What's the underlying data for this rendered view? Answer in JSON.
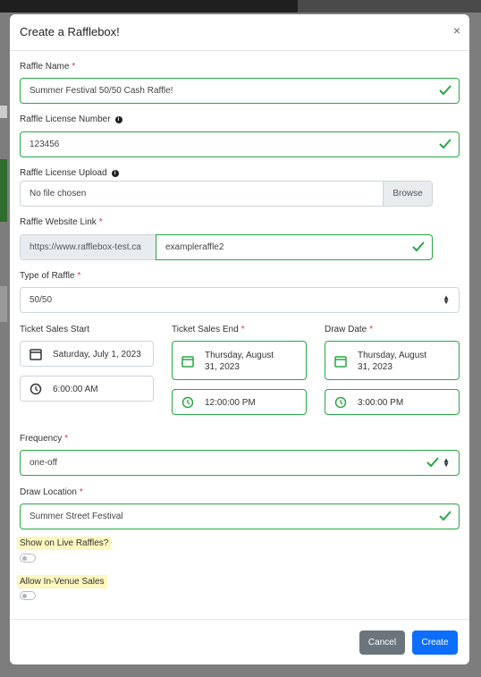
{
  "modal": {
    "title": "Create a Rafflebox!",
    "close_glyph": "×"
  },
  "raffle_name": {
    "label": "Raffle Name",
    "required": "*",
    "value": "Summer Festival 50/50 Cash Raffle!"
  },
  "license_number": {
    "label": "Raffle License Number",
    "info": "i",
    "value": "123456"
  },
  "license_upload": {
    "label": "Raffle License Upload",
    "info": "i",
    "value": "No file chosen",
    "button": "Browse"
  },
  "website_link": {
    "label": "Raffle Website Link",
    "required": "*",
    "prefix": "https://www.rafflebox-test.ca",
    "value": "exampleraffle2"
  },
  "raffle_type": {
    "label": "Type of Raffle",
    "required": "*",
    "value": "50/50"
  },
  "ticket_sales_start": {
    "label": "Ticket Sales Start",
    "date": "Saturday, July 1, 2023",
    "time": "6:00:00 AM"
  },
  "ticket_sales_end": {
    "label": "Ticket Sales End",
    "required": "*",
    "date_line1": "Thursday, August",
    "date_line2": "31, 2023",
    "time": "12:00:00 PM"
  },
  "draw_date": {
    "label": "Draw Date",
    "required": "*",
    "date_line1": "Thursday, August",
    "date_line2": "31, 2023",
    "time": "3:00:00 PM"
  },
  "frequency": {
    "label": "Frequency",
    "required": "*",
    "value": "one-off"
  },
  "draw_location": {
    "label": "Draw Location",
    "required": "*",
    "value": "Summer Street Festival"
  },
  "show_live": {
    "label": "Show on Live Raffles?",
    "enabled": false
  },
  "in_venue": {
    "label": "Allow In-Venue Sales",
    "enabled": false
  },
  "footer": {
    "cancel": "Cancel",
    "create": "Create"
  },
  "colors": {
    "valid": "#28a745",
    "primary": "#0d6efd",
    "secondary": "#6c757d",
    "required": "#dc3545",
    "highlight": "#fdf7c0"
  },
  "icons": [
    "check-icon",
    "calendar-icon",
    "clock-icon",
    "info-icon",
    "select-arrows-icon",
    "close-icon"
  ]
}
